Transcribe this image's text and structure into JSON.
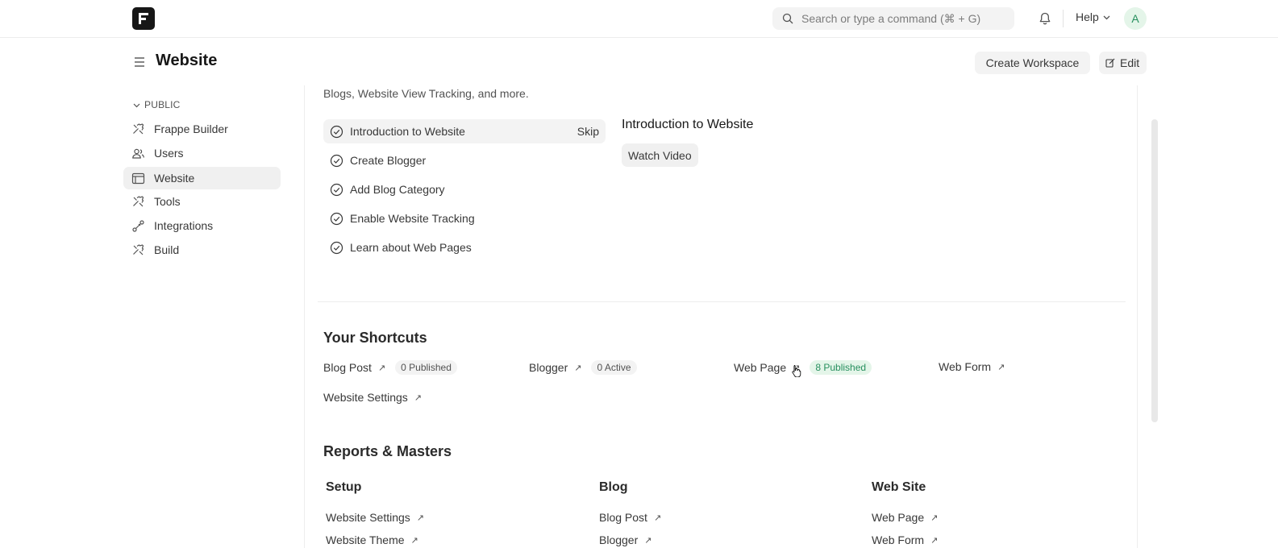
{
  "navbar": {
    "search_placeholder": "Search or type a command (⌘ + G)",
    "help_label": "Help",
    "avatar_initial": "A"
  },
  "header": {
    "title": "Website",
    "create_workspace_label": "Create Workspace",
    "edit_label": "Edit"
  },
  "sidebar": {
    "section_label": "PUBLIC",
    "items": [
      {
        "label": "Frappe Builder",
        "icon": "tools-icon"
      },
      {
        "label": "Users",
        "icon": "users-icon"
      },
      {
        "label": "Website",
        "icon": "browser-icon"
      },
      {
        "label": "Tools",
        "icon": "tools-icon"
      },
      {
        "label": "Integrations",
        "icon": "integration-icon"
      },
      {
        "label": "Build",
        "icon": "tools-icon"
      }
    ]
  },
  "onboarding": {
    "intro_text": "Blogs, Website View Tracking, and more.",
    "steps": [
      {
        "label": "Introduction to Website"
      },
      {
        "label": "Create Blogger"
      },
      {
        "label": "Add Blog Category"
      },
      {
        "label": "Enable Website Tracking"
      },
      {
        "label": "Learn about Web Pages"
      }
    ],
    "skip_label": "Skip",
    "detail_title": "Introduction to Website",
    "watch_video_label": "Watch Video"
  },
  "shortcuts": {
    "title": "Your Shortcuts",
    "items": [
      {
        "label": "Blog Post",
        "pill": "0 Published"
      },
      {
        "label": "Blogger",
        "pill": "0 Active"
      },
      {
        "label": "Web Page",
        "pill": "8 Published"
      },
      {
        "label": "Web Form"
      },
      {
        "label": "Website Settings"
      }
    ]
  },
  "reports": {
    "title": "Reports & Masters",
    "cards": [
      {
        "title": "Setup",
        "links": [
          "Website Settings",
          "Website Theme"
        ]
      },
      {
        "title": "Blog",
        "links": [
          "Blog Post",
          "Blogger"
        ]
      },
      {
        "title": "Web Site",
        "links": [
          "Web Page",
          "Web Form"
        ]
      }
    ]
  },
  "colors": {
    "accent_green": "#278f5e",
    "active_bg": "#f0f0f0"
  }
}
